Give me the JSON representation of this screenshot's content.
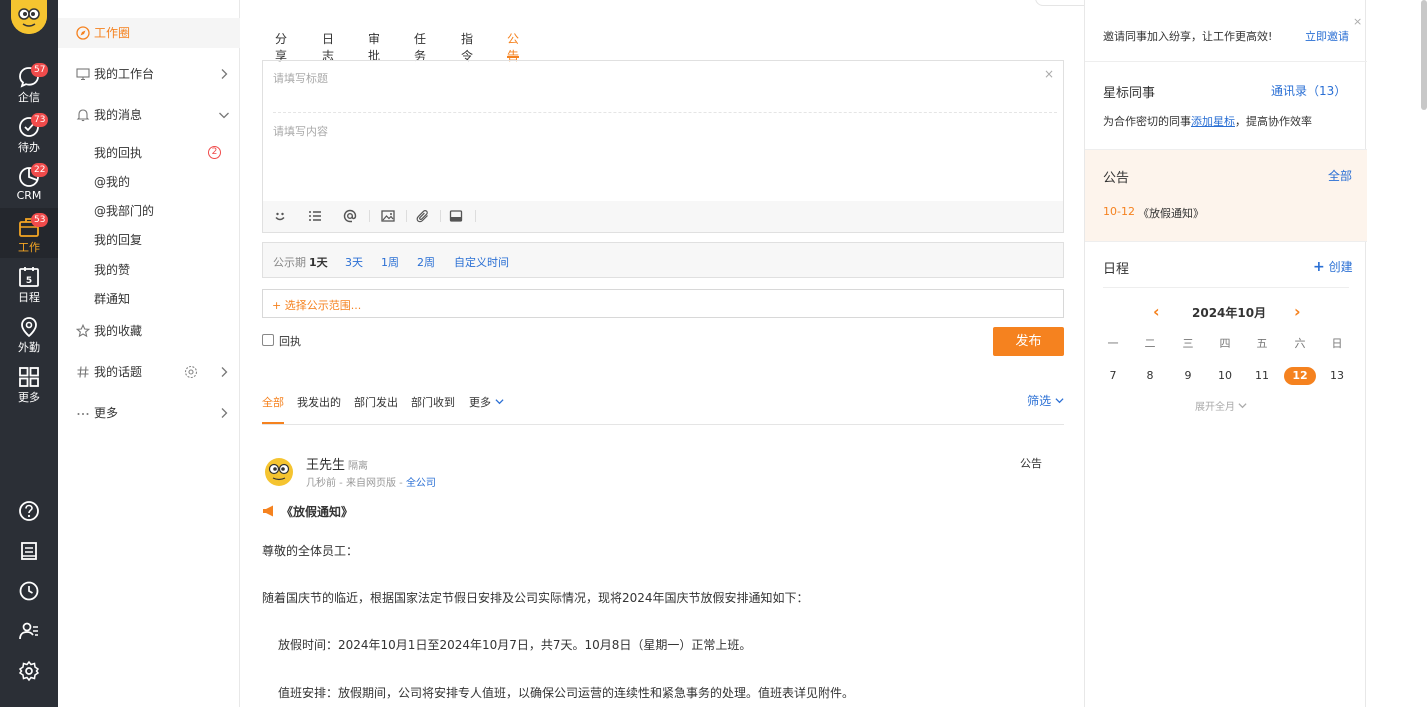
{
  "rail": {
    "items": [
      {
        "label": "企信",
        "badge": "57"
      },
      {
        "label": "待办",
        "badge": "73"
      },
      {
        "label": "CRM",
        "badge": "22"
      },
      {
        "label": "工作",
        "badge": "53"
      },
      {
        "label": "日程",
        "badge": ""
      },
      {
        "label": "外勤",
        "badge": ""
      },
      {
        "label": "更多",
        "badge": ""
      }
    ],
    "calendar_day": "5"
  },
  "nav": {
    "work_circle": "工作圈",
    "my_workbench": "我的工作台",
    "my_messages": "我的消息",
    "subs": [
      "我的回执",
      "@我的",
      "@我部门的",
      "我的回复",
      "我的赞",
      "群通知"
    ],
    "receipt_count": "2",
    "my_favorites": "我的收藏",
    "my_topics": "我的话题",
    "more": "更多"
  },
  "tabs": [
    "分享",
    "日志",
    "审批",
    "任务",
    "指令",
    "公告"
  ],
  "composer": {
    "title_placeholder": "请填写标题",
    "body_placeholder": "请填写内容",
    "close": "×"
  },
  "period": {
    "label": "公示期",
    "selected": "1天",
    "options": [
      "3天",
      "1周",
      "2周",
      "自定义时间"
    ]
  },
  "scope": "+ 选择公示范围...",
  "receipt_label": "回执",
  "publish": "发布",
  "filters": {
    "tabs": [
      "全部",
      "我发出的",
      "部门发出",
      "部门收到",
      "更多"
    ],
    "filter": "筛选"
  },
  "post": {
    "author": "王先生",
    "tag": "隔离",
    "meta_prefix": "几秒前 - 来自网页版 - ",
    "meta_link": "全公司",
    "type": "公告",
    "heading": "《放假通知》",
    "lines": [
      "尊敬的全体员工：",
      "随着国庆节的临近，根据国家法定节假日安排及公司实际情况，现将2024年国庆节放假安排通知如下：",
      "放假时间：2024年10月1日至2024年10月7日，共7天。10月8日（星期一）正常上班。",
      "值班安排：放假期间，公司将安排专人值班，以确保公司运营的连续性和紧急事务的处理。值班表详见附件。"
    ]
  },
  "right": {
    "invite_text": "邀请同事加入纷享，让工作更高效!",
    "invite_action": "立即邀请",
    "close": "×",
    "star_title": "星标同事",
    "contacts": "通讯录（13）",
    "star_desc_prefix": "为合作密切的同事",
    "star_desc_link": "添加星标",
    "star_desc_suffix": "，提高协作效率",
    "notice_title": "公告",
    "notice_all": "全部",
    "notice_date": "10-12",
    "notice_item": "《放假通知》",
    "schedule_title": "日程",
    "create": "创建",
    "create_plus": "+",
    "month": "2024年10月",
    "weekdays": [
      "一",
      "二",
      "三",
      "四",
      "五",
      "六",
      "日"
    ],
    "days": [
      "7",
      "8",
      "9",
      "10",
      "11",
      "12",
      "13"
    ],
    "expand": "展开全月"
  },
  "colors": {
    "accent": "#f5821f",
    "link": "#2a6fd4",
    "rail_bg": "#2b2f36",
    "badge": "#f04b4b"
  }
}
